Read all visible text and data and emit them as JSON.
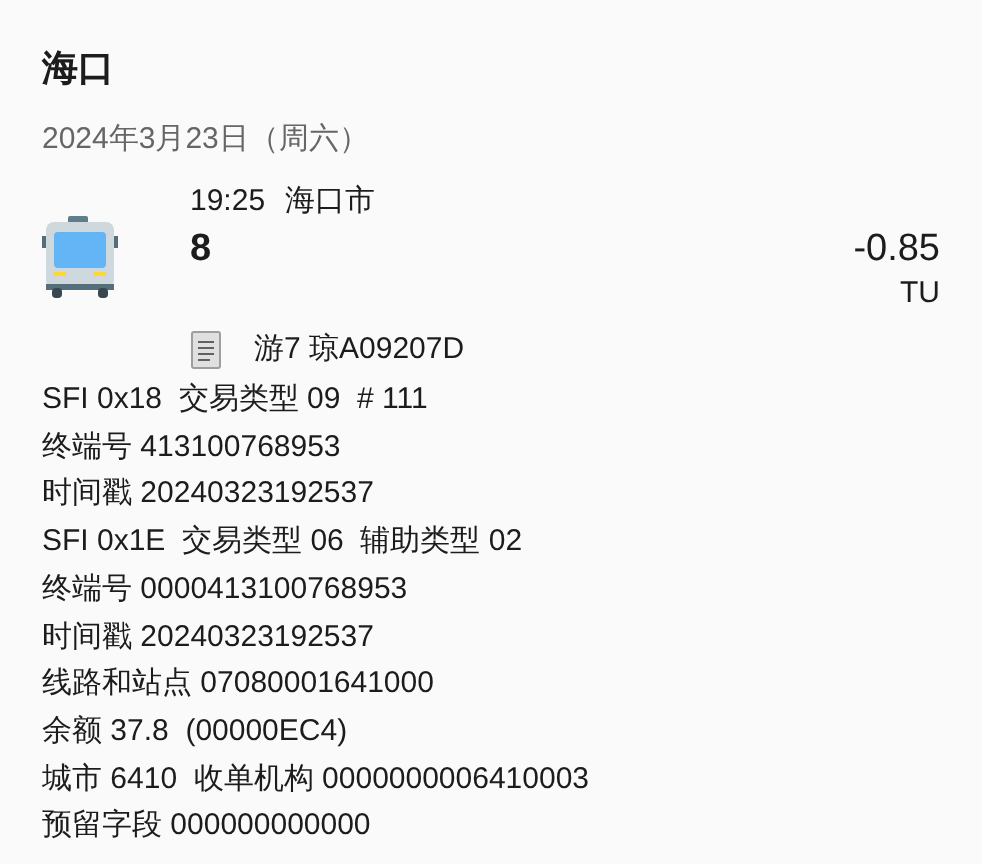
{
  "city": "海口",
  "date": "2024年3月23日（周六）",
  "transaction": {
    "time": "19:25",
    "place": "海口市",
    "route": "8",
    "amount": "-0.85",
    "currency": "TU",
    "note": "游7 琼A09207D"
  },
  "details": [
    "SFI 0x18  交易类型 09  # 111",
    "终端号 413100768953",
    "时间戳 20240323192537",
    "SFI 0x1E  交易类型 06  辅助类型 02",
    "终端号 0000413100768953",
    "时间戳 20240323192537",
    "线路和站点 07080001641000",
    "余额 37.8  (00000EC4)",
    "城市 6410  收单机构 0000000006410003",
    "预留字段 000000000000"
  ]
}
